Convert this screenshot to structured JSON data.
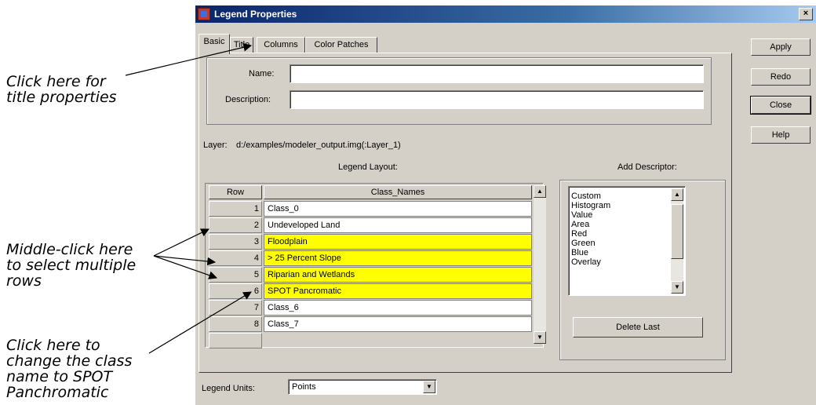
{
  "annotations": {
    "title_props": [
      "Click here for",
      "title properties"
    ],
    "middle_click": [
      "Middle-click here",
      "to select multiple",
      "rows"
    ],
    "change_name": [
      "Click here to",
      "change the class",
      "name to SPOT",
      "Panchromatic"
    ]
  },
  "window": {
    "title": "Legend Properties",
    "close_glyph": "×"
  },
  "tabs": [
    "Basic",
    "Title",
    "Columns",
    "Color Patches"
  ],
  "basic": {
    "name_label": "Name:",
    "name_value": "",
    "description_label": "Description:",
    "description_value": "",
    "layer_label": "Layer:",
    "layer_value": "d:/examples/modeler_output.img(:Layer_1)",
    "legend_layout_label": "Legend Layout:",
    "add_descriptor_label": "Add Descriptor:"
  },
  "grid": {
    "headers": {
      "row": "Row",
      "class_names": "Class_Names"
    },
    "rows": [
      {
        "row": "1",
        "name": "Class_0",
        "selected": false
      },
      {
        "row": "2",
        "name": "Undeveloped Land",
        "selected": false
      },
      {
        "row": "3",
        "name": "Floodplain",
        "selected": true
      },
      {
        "row": "4",
        "name": "> 25 Percent Slope",
        "selected": true
      },
      {
        "row": "5",
        "name": "Riparian and Wetlands",
        "selected": true
      },
      {
        "row": "6",
        "name": "SPOT Pancromatic",
        "selected": true
      },
      {
        "row": "7",
        "name": "Class_6",
        "selected": false
      },
      {
        "row": "8",
        "name": "Class_7",
        "selected": false
      }
    ]
  },
  "descriptors": {
    "items": [
      "Custom",
      "Histogram",
      "Value",
      "Area",
      "Red",
      "Green",
      "Blue",
      "Overlay"
    ],
    "delete_label": "Delete Last"
  },
  "buttons": {
    "apply": "Apply",
    "redo": "Redo",
    "close": "Close",
    "help": "Help"
  },
  "legend_units": {
    "label": "Legend Units:",
    "value": "Points"
  },
  "icons": {
    "scroll_up": "up-arrow-icon",
    "scroll_down": "down-arrow-icon",
    "dropdown": "chevron-down-icon",
    "app": "app-icon"
  },
  "colors": {
    "selected_row": "#ffff00",
    "window_bg": "#d4d0c8",
    "title_bar": "#0a246a"
  }
}
